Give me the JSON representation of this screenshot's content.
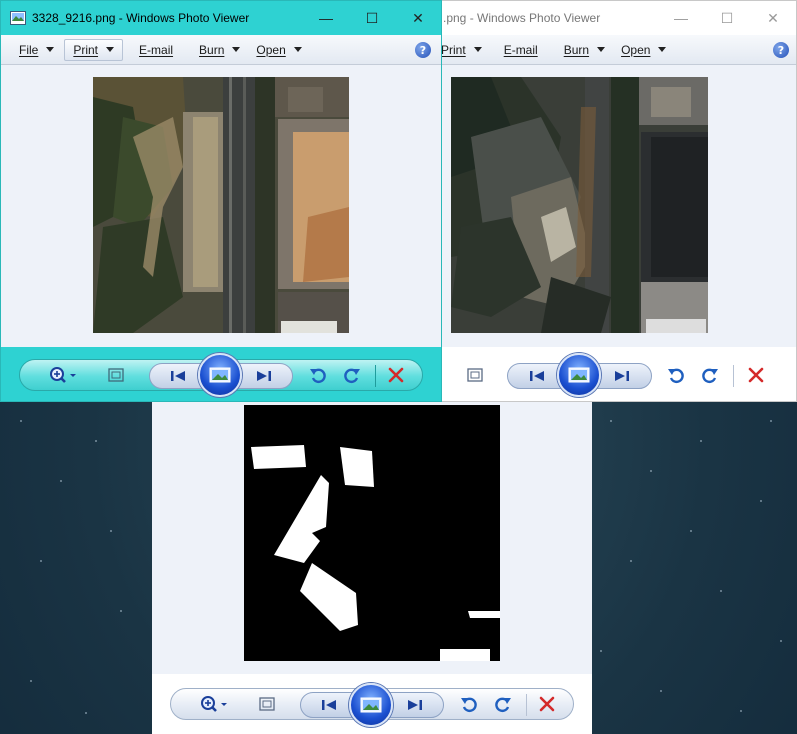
{
  "desktop": {
    "background": "#1c3646"
  },
  "back_window": {
    "title": "3328_9216.png - Windows Photo Viewer",
    "title_visible": ".png - Windows Photo Viewer",
    "menu": [
      {
        "label": "Print",
        "caret": true
      },
      {
        "label": "E-mail",
        "caret": false
      },
      {
        "label": "Burn",
        "caret": true
      },
      {
        "label": "Open",
        "caret": true
      }
    ],
    "help_label": "?",
    "controls": {
      "minimize": "—",
      "maximize": "☐",
      "close": "✕"
    },
    "image": "satellite-photo-2"
  },
  "front_window": {
    "title": "3328_9216.png - Windows Photo Viewer",
    "menu": [
      {
        "label": "File",
        "caret": true
      },
      {
        "label": "Print",
        "caret": true
      },
      {
        "label": "E-mail",
        "caret": false
      },
      {
        "label": "Burn",
        "caret": true
      },
      {
        "label": "Open",
        "caret": true
      }
    ],
    "help_label": "?",
    "controls": {
      "minimize": "—",
      "maximize": "☐",
      "close": "✕"
    },
    "accent": "#2ed2d2",
    "image": "satellite-photo-1"
  },
  "mask_window": {
    "image": "building-mask"
  },
  "toolbar_icons": [
    "zoom-icon",
    "actual-size-icon",
    "previous-icon",
    "slideshow-icon",
    "next-icon",
    "rotate-ccw-icon",
    "rotate-cw-icon",
    "delete-icon"
  ],
  "colors": {
    "delete": "#d42a2a",
    "rotate": "#1f5fbf",
    "nav": "#1a3f9a"
  }
}
